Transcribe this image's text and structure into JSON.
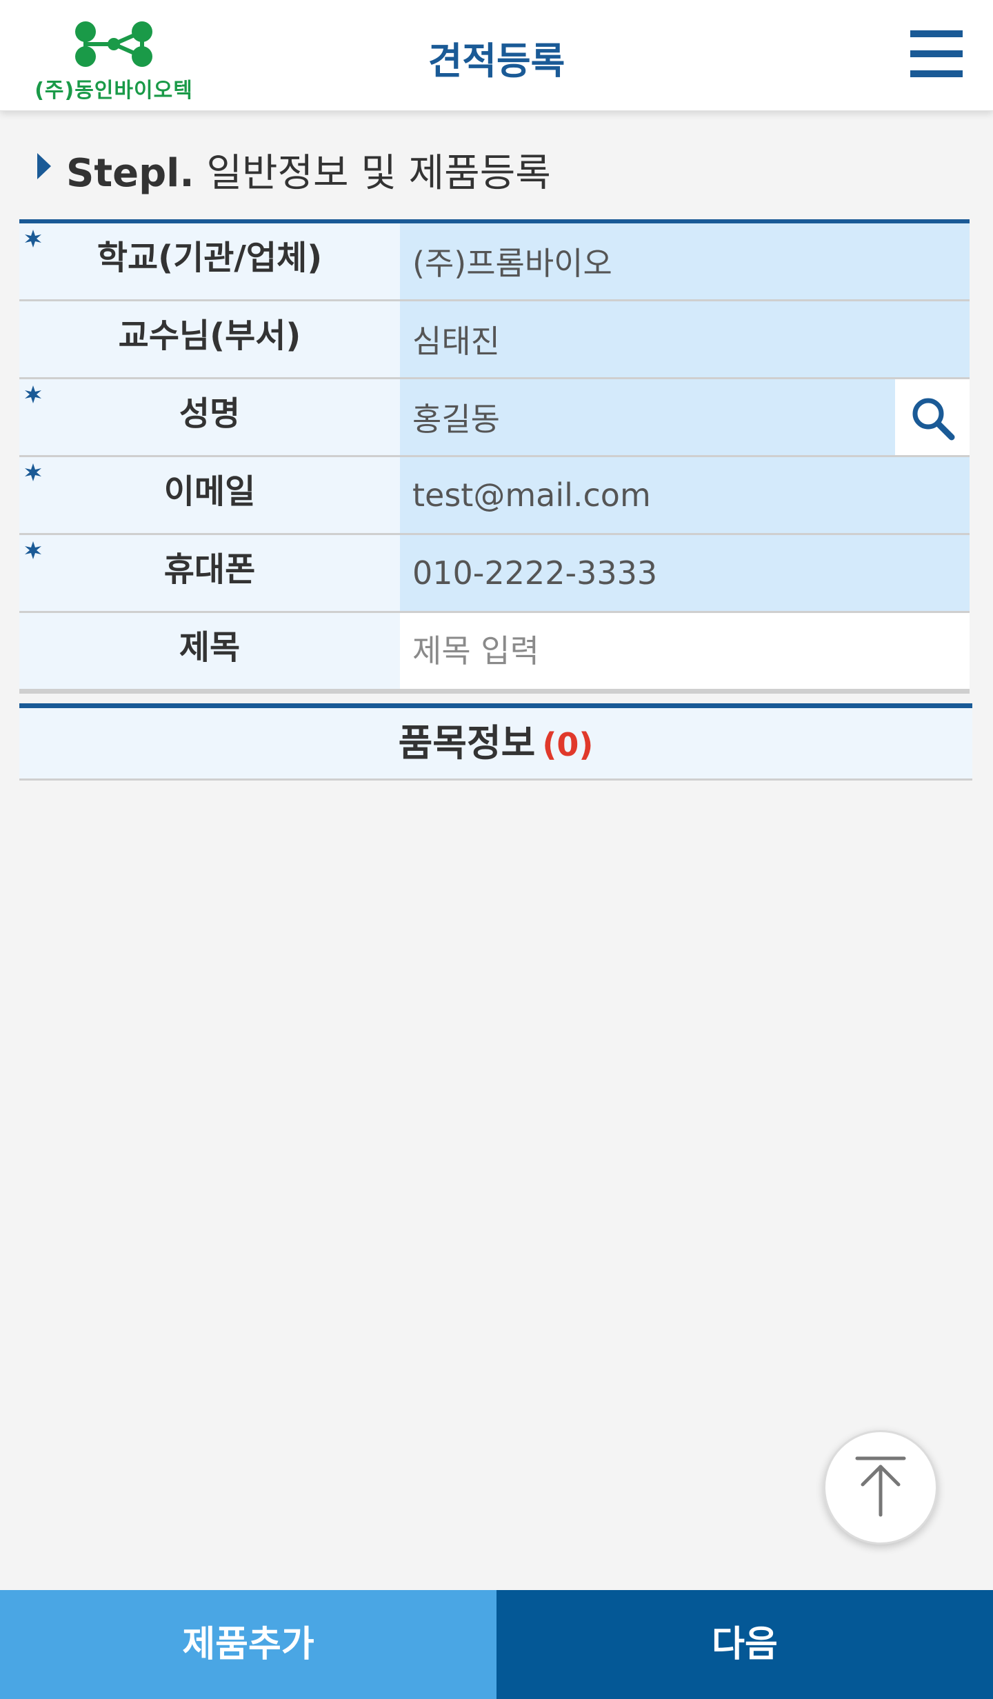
{
  "header": {
    "logo_text": "(주)동인바이오텍",
    "title": "견적등록",
    "menu_icon": "hamburger-menu-icon"
  },
  "step": {
    "prefix": "Stepl.",
    "title": "일반정보 및 제품등록"
  },
  "form": {
    "rows": [
      {
        "label": "학교(기관/업체)",
        "required": true,
        "value": "(주)프롬바이오",
        "placeholder": ""
      },
      {
        "label": "교수님(부서)",
        "required": false,
        "value": "심태진",
        "placeholder": ""
      },
      {
        "label": "성명",
        "required": true,
        "value": "홍길동",
        "placeholder": "",
        "has_search": true
      },
      {
        "label": "이메일",
        "required": true,
        "value": "test@mail.com",
        "placeholder": ""
      },
      {
        "label": "휴대폰",
        "required": true,
        "value": "010-2222-3333",
        "placeholder": ""
      },
      {
        "label": "제목",
        "required": false,
        "value": "",
        "placeholder": "제목 입력"
      }
    ]
  },
  "items": {
    "title": "품목정보",
    "count": "(0)"
  },
  "bottom": {
    "add_label": "제품추가",
    "next_label": "다음"
  },
  "colors": {
    "primary": "#1a5a96",
    "field_bg": "#d4eafb",
    "label_bg": "#eef6fd",
    "add_button": "#4aa6e4",
    "next_button": "#045896",
    "count_red": "#e0392b",
    "logo_green": "#1a9a48"
  }
}
